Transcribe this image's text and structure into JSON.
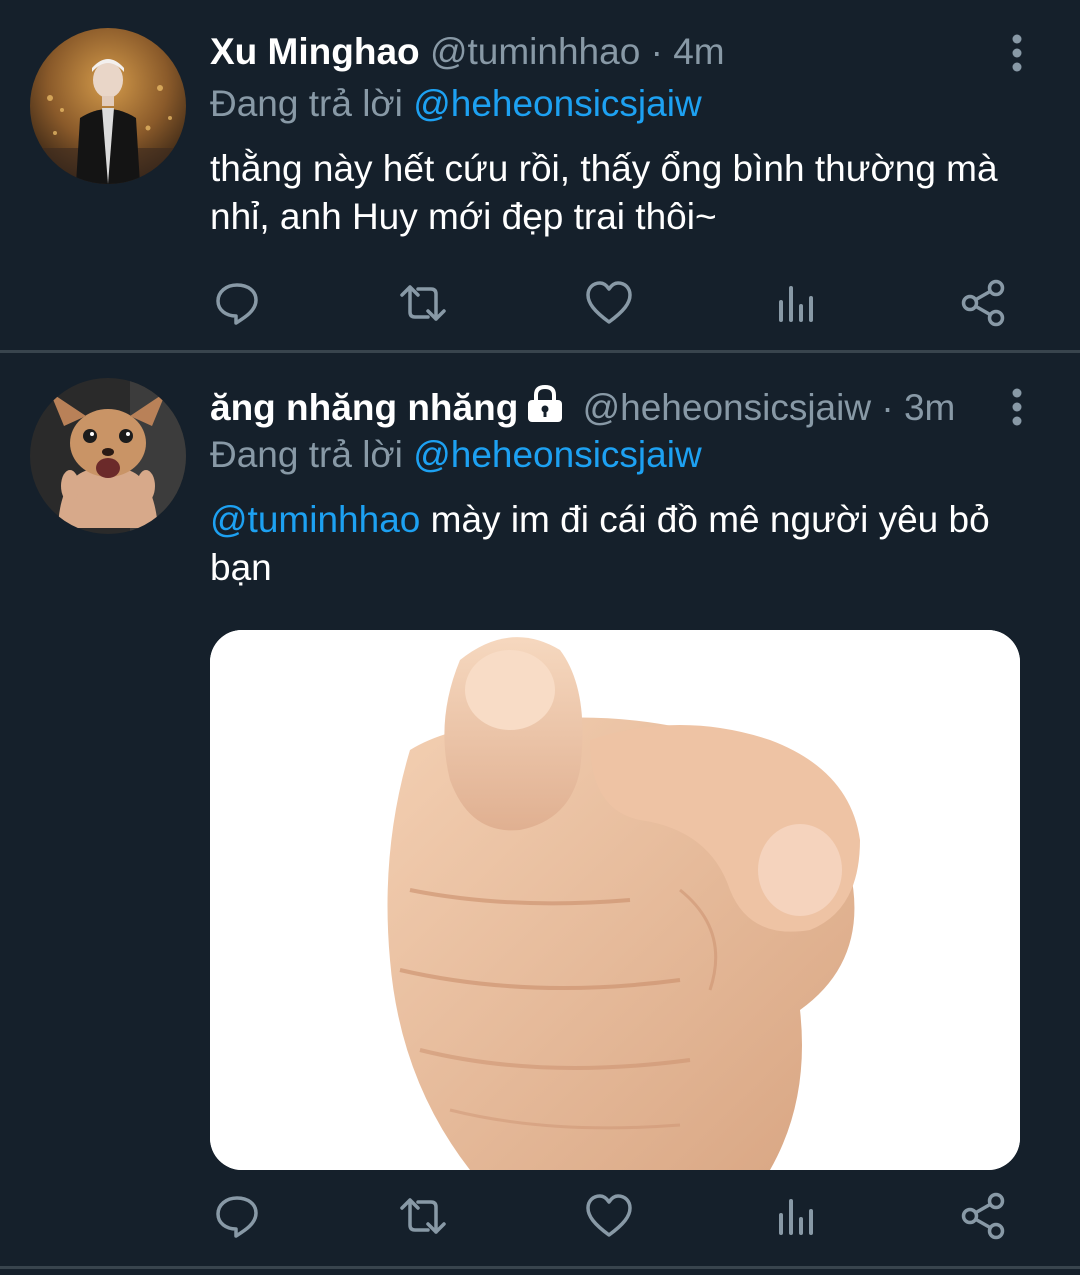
{
  "colors": {
    "background": "#15202b",
    "divider": "#38444d",
    "secondary_text": "#8899a6",
    "mention": "#1da1f2",
    "text": "#ffffff"
  },
  "tweets": [
    {
      "display_name": "Xu Minghao",
      "handle": "@tuminhhao",
      "separator": "·",
      "time": "4m",
      "protected": false,
      "reply_prefix": "Đang trả lời",
      "reply_to": "@heheonsicsjaiw",
      "text": "thằng này hết cứu rồi, thấy ổng bình thường mà nhỉ, anh Huy mới đẹp trai thôi~",
      "avatar_icon": "person-photo-avatar",
      "actions": [
        "reply-icon",
        "retweet-icon",
        "like-icon",
        "analytics-icon",
        "share-icon"
      ]
    },
    {
      "display_name": "ăng nhăng nhăng",
      "handle": "@heheonsicsjaiw",
      "separator": "·",
      "time": "3m",
      "protected": true,
      "reply_prefix": "Đang trả lời",
      "reply_to": "@heheonsicsjaiw",
      "text_mention": "@tuminhhao",
      "text": "mày im đi cái đồ mê người yêu bỏ bạn",
      "avatar_icon": "dog-photo-avatar",
      "media_icon": "pointing-hand-image",
      "actions": [
        "reply-icon",
        "retweet-icon",
        "like-icon",
        "analytics-icon",
        "share-icon"
      ]
    }
  ]
}
